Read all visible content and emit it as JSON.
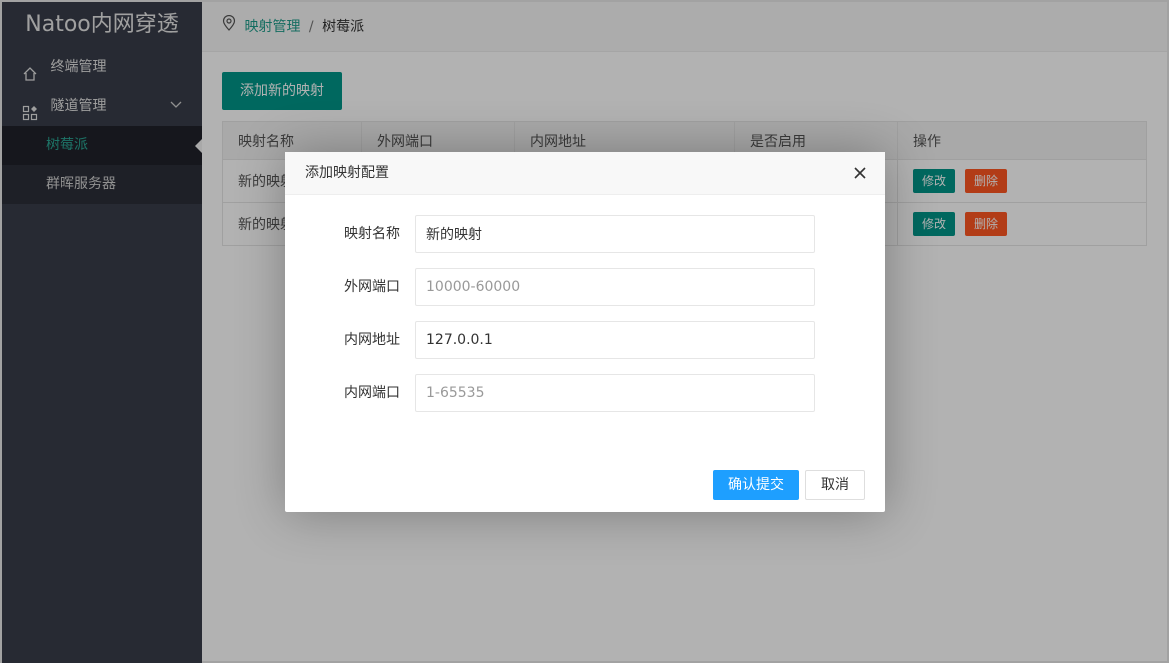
{
  "sidebar": {
    "app_title": "Natoo内网穿透",
    "items": [
      {
        "label": "终端管理"
      },
      {
        "label": "隧道管理",
        "children": [
          {
            "label": "树莓派"
          },
          {
            "label": "群晖服务器"
          }
        ]
      }
    ]
  },
  "breadcrumb": {
    "parent": "映射管理",
    "separator": "/",
    "current": "树莓派"
  },
  "toolbar": {
    "add_label": "添加新的映射"
  },
  "table": {
    "headers": [
      "映射名称",
      "外网端口",
      "内网地址",
      "是否启用",
      "操作"
    ],
    "rows": [
      {
        "name": "新的映射",
        "edit": "修改",
        "delete": "删除"
      },
      {
        "name": "新的映射",
        "edit": "修改",
        "delete": "删除"
      }
    ]
  },
  "dialog": {
    "title": "添加映射配置",
    "fields": [
      {
        "label": "映射名称",
        "value": "新的映射",
        "placeholder": ""
      },
      {
        "label": "外网端口",
        "value": "",
        "placeholder": "10000-60000"
      },
      {
        "label": "内网地址",
        "value": "127.0.0.1",
        "placeholder": ""
      },
      {
        "label": "内网端口",
        "value": "",
        "placeholder": "1-65535"
      }
    ],
    "submit_label": "确认提交",
    "cancel_label": "取消"
  },
  "colors": {
    "accent": "#009688",
    "primary": "#1e9fff",
    "danger": "#ff5722",
    "sidebar": "#393d49"
  },
  "icons": {
    "home": "home-icon",
    "tunnel": "apps-icon",
    "chevron": "chevron-down-icon",
    "location": "location-pin-icon",
    "close": "close-icon"
  }
}
